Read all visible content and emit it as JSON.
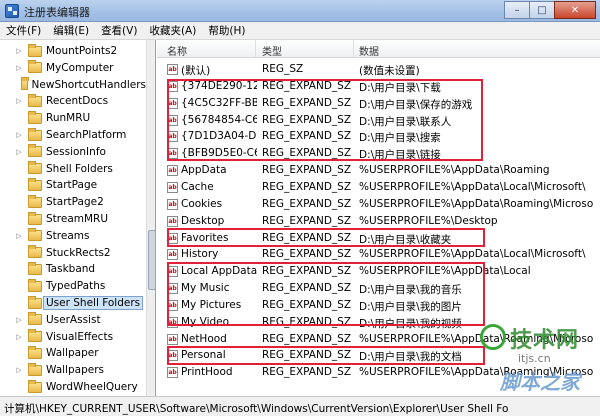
{
  "window": {
    "title": "注册表编辑器",
    "buttons": {
      "minimize": "–",
      "maximize": "□",
      "close": "✕"
    }
  },
  "menu": [
    "文件(F)",
    "编辑(E)",
    "查看(V)",
    "收藏夹(A)",
    "帮助(H)"
  ],
  "tree": {
    "items": [
      {
        "label": "MountPoints2",
        "expander": "▷",
        "selected": false
      },
      {
        "label": "MyComputer",
        "expander": "▷",
        "selected": false
      },
      {
        "label": "NewShortcutHandlers",
        "expander": "",
        "selected": false
      },
      {
        "label": "RecentDocs",
        "expander": "▷",
        "selected": false
      },
      {
        "label": "RunMRU",
        "expander": "",
        "selected": false
      },
      {
        "label": "SearchPlatform",
        "expander": "▷",
        "selected": false
      },
      {
        "label": "SessionInfo",
        "expander": "▷",
        "selected": false
      },
      {
        "label": "Shell Folders",
        "expander": "",
        "selected": false
      },
      {
        "label": "StartPage",
        "expander": "",
        "selected": false
      },
      {
        "label": "StartPage2",
        "expander": "",
        "selected": false
      },
      {
        "label": "StreamMRU",
        "expander": "",
        "selected": false
      },
      {
        "label": "Streams",
        "expander": "▷",
        "selected": false
      },
      {
        "label": "StuckRects2",
        "expander": "",
        "selected": false
      },
      {
        "label": "Taskband",
        "expander": "",
        "selected": false
      },
      {
        "label": "TypedPaths",
        "expander": "",
        "selected": false
      },
      {
        "label": "User Shell Folders",
        "expander": "",
        "selected": true
      },
      {
        "label": "UserAssist",
        "expander": "▷",
        "selected": false
      },
      {
        "label": "VisualEffects",
        "expander": "▷",
        "selected": false
      },
      {
        "label": "Wallpaper",
        "expander": "",
        "selected": false
      },
      {
        "label": "Wallpapers",
        "expander": "▷",
        "selected": false
      },
      {
        "label": "WordWheelQuery",
        "expander": "",
        "selected": false
      }
    ]
  },
  "columns": {
    "name": "名称",
    "type": "类型",
    "data": "数据"
  },
  "values": [
    {
      "name": "(默认)",
      "type": "REG_SZ",
      "data": "(数值未设置)"
    },
    {
      "name": "{374DE290-12...",
      "type": "REG_EXPAND_SZ",
      "data": "D:\\用户目录\\下载"
    },
    {
      "name": "{4C5C32FF-BB...",
      "type": "REG_EXPAND_SZ",
      "data": "D:\\用户目录\\保存的游戏"
    },
    {
      "name": "{56784854-C6...",
      "type": "REG_EXPAND_SZ",
      "data": "D:\\用户目录\\联系人"
    },
    {
      "name": "{7D1D3A04-DE...",
      "type": "REG_EXPAND_SZ",
      "data": "D:\\用户目录\\搜索"
    },
    {
      "name": "{BFB9D5E0-C6...",
      "type": "REG_EXPAND_SZ",
      "data": "D:\\用户目录\\链接"
    },
    {
      "name": "AppData",
      "type": "REG_EXPAND_SZ",
      "data": "%USERPROFILE%\\AppData\\Roaming"
    },
    {
      "name": "Cache",
      "type": "REG_EXPAND_SZ",
      "data": "%USERPROFILE%\\AppData\\Local\\Microsoft\\"
    },
    {
      "name": "Cookies",
      "type": "REG_EXPAND_SZ",
      "data": "%USERPROFILE%\\AppData\\Roaming\\Microso"
    },
    {
      "name": "Desktop",
      "type": "REG_EXPAND_SZ",
      "data": "%USERPROFILE%\\Desktop"
    },
    {
      "name": "Favorites",
      "type": "REG_EXPAND_SZ",
      "data": "D:\\用户目录\\收藏夹"
    },
    {
      "name": "History",
      "type": "REG_EXPAND_SZ",
      "data": "%USERPROFILE%\\AppData\\Local\\Microsoft\\"
    },
    {
      "name": "Local AppData",
      "type": "REG_EXPAND_SZ",
      "data": "%USERPROFILE%\\AppData\\Local"
    },
    {
      "name": "My Music",
      "type": "REG_EXPAND_SZ",
      "data": "D:\\用户目录\\我的音乐"
    },
    {
      "name": "My Pictures",
      "type": "REG_EXPAND_SZ",
      "data": "D:\\用户目录\\我的图片"
    },
    {
      "name": "My Video",
      "type": "REG_EXPAND_SZ",
      "data": "D:\\用户目录\\我的视频"
    },
    {
      "name": "NetHood",
      "type": "REG_EXPAND_SZ",
      "data": "%USERPROFILE%\\AppData\\Roaming\\Microso"
    },
    {
      "name": "Personal",
      "type": "REG_EXPAND_SZ",
      "data": "D:\\用户目录\\我的文档"
    },
    {
      "name": "PrintHood",
      "type": "REG_EXPAND_SZ",
      "data": "%USERPROFILE%\\AppData\\Roaming\\Microso"
    }
  ],
  "value_icon_text": "ab",
  "status": "计算机\\HKEY_CURRENT_USER\\Software\\Microsoft\\Windows\\CurrentVersion\\Explorer\\User Shell Fo",
  "watermark": {
    "main": "技术网",
    "sub": "itjs.cn",
    "script": "脚本之家"
  },
  "colors": {
    "highlight_box": "#e3203a",
    "selection": "#cde3f7"
  }
}
